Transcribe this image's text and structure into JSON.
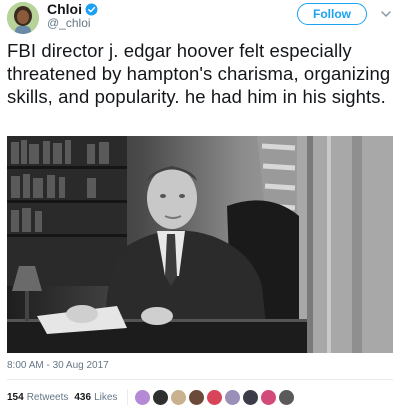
{
  "tweet": {
    "display_name": "Chloi",
    "handle": "@_chloi",
    "verified": true,
    "follow_label": "Follow",
    "text": "FBI director j. edgar hoover felt especially threatened by hampton's charisma, organizing skills, and popularity. he had him in his sights.",
    "timestamp": "8:00 AM - 30 Aug 2017",
    "retweets_count": "154",
    "retweets_label": "Retweets",
    "likes_count": "436",
    "likes_label": "Likes"
  },
  "icons": {
    "verified": "verified-badge-icon",
    "caret": "chevron-down-icon"
  },
  "colors": {
    "accent": "#1da1f2",
    "secondary_text": "#657786",
    "primary_text": "#14171a"
  }
}
